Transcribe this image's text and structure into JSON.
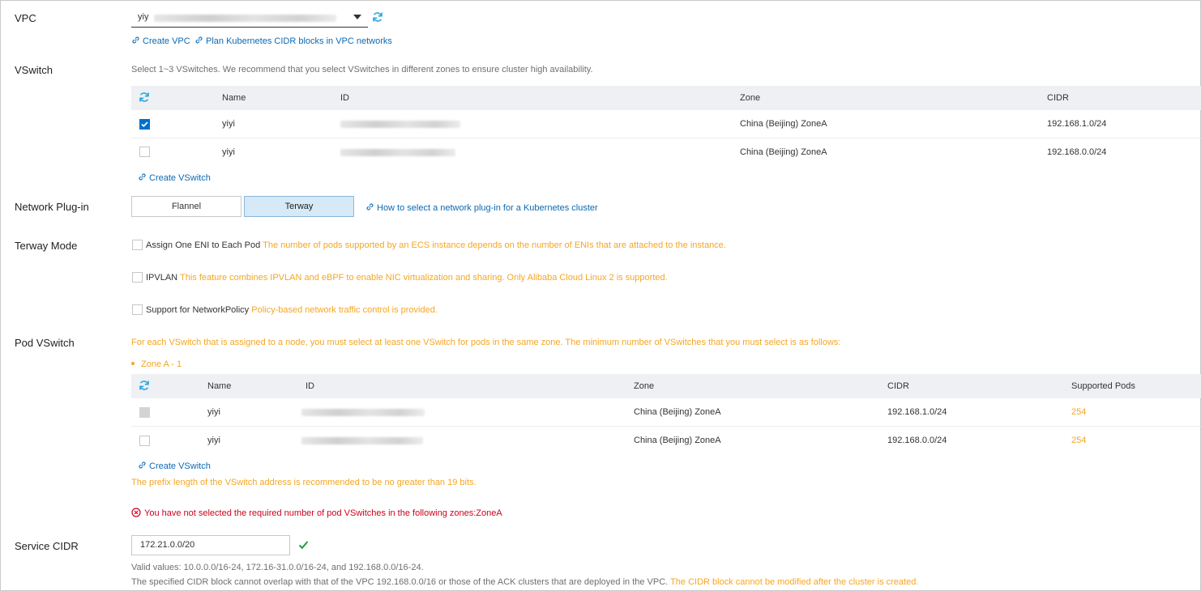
{
  "vpc": {
    "label": "VPC",
    "selected_prefix": "yiy",
    "links": {
      "create_vpc": "Create VPC",
      "plan": "Plan Kubernetes CIDR blocks in VPC networks"
    }
  },
  "vswitch": {
    "label": "VSwitch",
    "hint": "Select 1~3 VSwitches. We recommend that you select VSwitches in different zones to ensure cluster high availability.",
    "columns": [
      "Name",
      "ID",
      "Zone",
      "CIDR"
    ],
    "rows": [
      {
        "checked": true,
        "name": "yiyi",
        "zone": "China (Beijing) ZoneA",
        "cidr": "192.168.1.0/24"
      },
      {
        "checked": false,
        "name": "yiyi",
        "zone": "China (Beijing) ZoneA",
        "cidr": "192.168.0.0/24"
      }
    ],
    "create_link": "Create VSwitch"
  },
  "network_plugin": {
    "label": "Network Plug-in",
    "options": [
      "Flannel",
      "Terway"
    ],
    "selected": "Terway",
    "help_link": "How to select a network plug-in for a Kubernetes cluster"
  },
  "terway_mode": {
    "label": "Terway Mode",
    "options": [
      {
        "label": "Assign One ENI to Each Pod",
        "note": "The number of pods supported by an ECS instance depends on the number of ENIs that are attached to the instance."
      },
      {
        "label": "IPVLAN",
        "note": "This feature combines IPVLAN and eBPF to enable NIC virtualization and sharing. Only Alibaba Cloud Linux 2 is supported."
      },
      {
        "label": "Support for NetworkPolicy",
        "note": "Policy-based network traffic control is provided."
      }
    ]
  },
  "pod_vswitch": {
    "label": "Pod VSwitch",
    "hint": "For each VSwitch that is assigned to a node, you must select at least one VSwitch for pods in the same zone. The minimum number of VSwitches that you must select is as follows:",
    "zone_requirement": "Zone A - 1",
    "columns": [
      "Name",
      "ID",
      "Zone",
      "CIDR",
      "Supported Pods"
    ],
    "rows": [
      {
        "name": "yiyi",
        "zone": "China (Beijing) ZoneA",
        "cidr": "192.168.1.0/24",
        "pods": "254"
      },
      {
        "name": "yiyi",
        "zone": "China (Beijing) ZoneA",
        "cidr": "192.168.0.0/24",
        "pods": "254"
      }
    ],
    "create_link": "Create VSwitch",
    "prefix_note": "The prefix length of the VSwitch address is recommended to be no greater than 19 bits.",
    "error": "You have not selected the required number of pod VSwitches in the following zones:ZoneA"
  },
  "service_cidr": {
    "label": "Service CIDR",
    "value": "172.21.0.0/20",
    "valid_values": "Valid values: 10.0.0.0/16-24, 172.16-31.0.0/16-24, and 192.168.0.0/16-24.",
    "overlap_note": "The specified CIDR block cannot overlap with that of the VPC 192.168.0.0/16 or those of the ACK clusters that are deployed in the VPC.",
    "immutable_note": "The CIDR block cannot be modified after the cluster is created."
  },
  "colors": {
    "link": "#0b6ab3",
    "warning": "#f5a623",
    "error": "#d0021b",
    "selected_bg": "#d6e9f7",
    "accent": "#0070cc"
  },
  "icons": [
    "refresh-icon",
    "link-icon",
    "check-icon",
    "error-circle-icon",
    "chevron-down-icon"
  ]
}
